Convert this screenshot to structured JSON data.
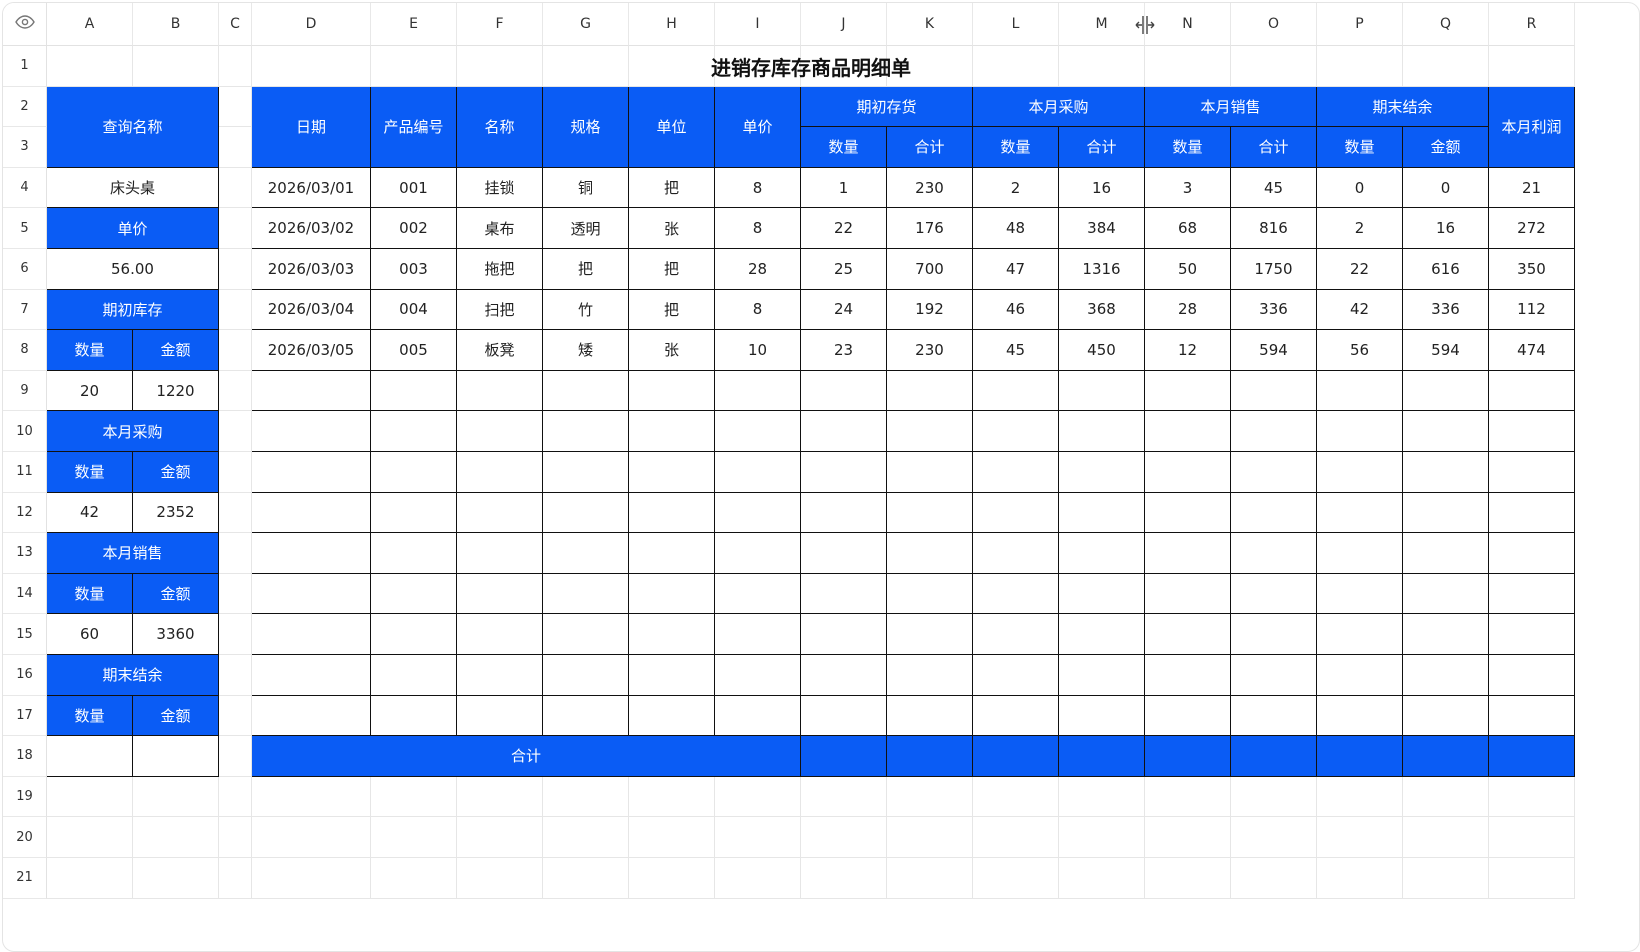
{
  "sheet": {
    "title": "进销存库存商品明细单",
    "column_headers": [
      "A",
      "B",
      "C",
      "D",
      "E",
      "F",
      "G",
      "H",
      "I",
      "J",
      "K",
      "L",
      "M",
      "N",
      "O",
      "P",
      "Q",
      "R"
    ],
    "row_headers": [
      "1",
      "2",
      "3",
      "4",
      "5",
      "6",
      "7",
      "8",
      "9",
      "10",
      "11",
      "12",
      "13",
      "14",
      "15",
      "16",
      "17",
      "18",
      "19",
      "20",
      "21"
    ]
  },
  "icons": {
    "corner": "eye-icon",
    "cursor": "column-resize-cursor-icon"
  },
  "colors": {
    "accent": "#0a5cf5",
    "border": "#111111",
    "grid": "#e6e6e6"
  },
  "side_panel": {
    "query_label": "查询名称",
    "query_value": "床头桌",
    "price_label": "单价",
    "price_value": "56.00",
    "sections": [
      {
        "label": "期初库存",
        "qty_label": "数量",
        "amt_label": "金额",
        "qty": "20",
        "amt": "1220"
      },
      {
        "label": "本月采购",
        "qty_label": "数量",
        "amt_label": "金额",
        "qty": "42",
        "amt": "2352"
      },
      {
        "label": "本月销售",
        "qty_label": "数量",
        "amt_label": "金额",
        "qty": "60",
        "amt": "3360"
      },
      {
        "label": "期末结余",
        "qty_label": "数量",
        "amt_label": "金额",
        "qty": "",
        "amt": ""
      }
    ]
  },
  "main_table": {
    "headers": [
      "日期",
      "产品编号",
      "名称",
      "规格",
      "单位",
      "单价"
    ],
    "groups": [
      {
        "label": "期初存货",
        "sub": [
          "数量",
          "合计"
        ]
      },
      {
        "label": "本月采购",
        "sub": [
          "数量",
          "合计"
        ]
      },
      {
        "label": "本月销售",
        "sub": [
          "数量",
          "合计"
        ]
      },
      {
        "label": "期末结余",
        "sub": [
          "数量",
          "金额"
        ]
      }
    ],
    "profit_header": "本月利润",
    "rows": [
      [
        "2026/03/01",
        "001",
        "挂锁",
        "铜",
        "把",
        "8",
        "1",
        "230",
        "2",
        "16",
        "3",
        "45",
        "0",
        "0",
        "21"
      ],
      [
        "2026/03/02",
        "002",
        "桌布",
        "透明",
        "张",
        "8",
        "22",
        "176",
        "48",
        "384",
        "68",
        "816",
        "2",
        "16",
        "272"
      ],
      [
        "2026/03/03",
        "003",
        "拖把",
        "把",
        "把",
        "28",
        "25",
        "700",
        "47",
        "1316",
        "50",
        "1750",
        "22",
        "616",
        "350"
      ],
      [
        "2026/03/04",
        "004",
        "扫把",
        "竹",
        "把",
        "8",
        "24",
        "192",
        "46",
        "368",
        "28",
        "336",
        "42",
        "336",
        "112"
      ],
      [
        "2026/03/05",
        "005",
        "板凳",
        "矮",
        "张",
        "10",
        "23",
        "230",
        "45",
        "450",
        "12",
        "594",
        "56",
        "594",
        "474"
      ]
    ],
    "empty_rows": 9,
    "total_label": "合计"
  }
}
